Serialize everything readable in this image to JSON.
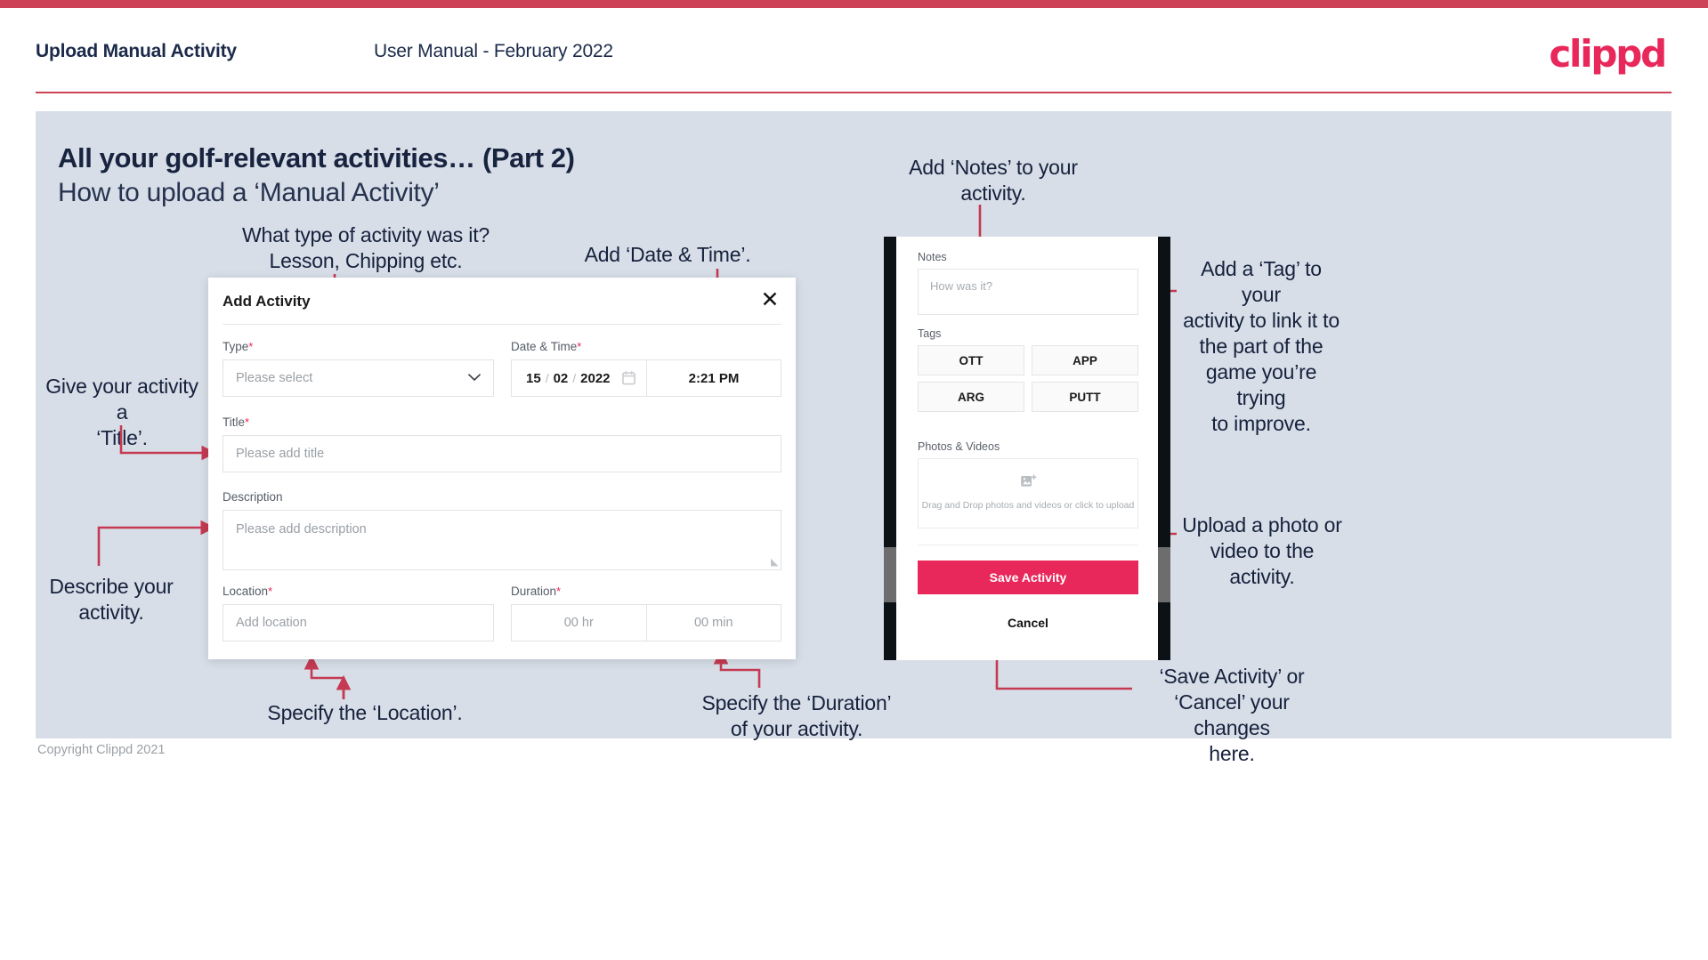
{
  "brand": {
    "logo_text": "clippd",
    "accent": "#e8275a",
    "bar": "#ce4257"
  },
  "header": {
    "left_title": "Upload Manual Activity",
    "center_title": "User Manual - February 2022"
  },
  "slide": {
    "title": "All your golf-relevant activities… (Part 2)",
    "subtitle": "How to upload a ‘Manual Activity’",
    "background": "#d7dee8"
  },
  "annotations": [
    {
      "id": "type-note",
      "text": "What type of activity was it?\nLesson, Chipping etc."
    },
    {
      "id": "datetime-note",
      "text": "Add ‘Date & Time’."
    },
    {
      "id": "title-note",
      "text": "Give your activity a\n‘Title’."
    },
    {
      "id": "describe-note",
      "text": "Describe your\nactivity."
    },
    {
      "id": "location-note",
      "text": "Specify the ‘Location’."
    },
    {
      "id": "duration-note",
      "text": "Specify the ‘Duration’\nof your activity."
    },
    {
      "id": "notes-note",
      "text": "Add ‘Notes’ to your\nactivity."
    },
    {
      "id": "tag-note",
      "text": "Add a ‘Tag’ to your\nactivity to link it to\nthe part of the\ngame you’re trying\nto improve."
    },
    {
      "id": "upload-note",
      "text": "Upload a photo or\nvideo to the activity."
    },
    {
      "id": "save-note",
      "text": "‘Save Activity’ or\n‘Cancel’ your changes\nhere."
    }
  ],
  "dialog": {
    "title": "Add Activity",
    "close_icon": "close-icon",
    "fields": {
      "type": {
        "label": "Type",
        "required": "*",
        "placeholder": "Please select",
        "icon": "chevron-down-icon"
      },
      "datetime": {
        "label": "Date & Time",
        "required": "*",
        "day": "15",
        "month": "02",
        "year": "2022",
        "sep": "/",
        "time": "2:21 PM",
        "icon": "calendar-icon"
      },
      "title": {
        "label": "Title",
        "required": "*",
        "placeholder": "Please add title"
      },
      "description": {
        "label": "Description",
        "required": "",
        "placeholder": "Please add description"
      },
      "location": {
        "label": "Location",
        "required": "*",
        "placeholder": "Add location"
      },
      "duration": {
        "label": "Duration",
        "required": "*",
        "hours": "00 hr",
        "minutes": "00 min"
      }
    }
  },
  "phone": {
    "notes": {
      "label": "Notes",
      "placeholder": "How was it?"
    },
    "tags": {
      "label": "Tags",
      "items": [
        "OTT",
        "APP",
        "ARG",
        "PUTT"
      ]
    },
    "media": {
      "label": "Photos & Videos",
      "icon": "add-image-icon",
      "drop_text": "Drag and Drop photos and videos or click to upload"
    },
    "save_label": "Save Activity",
    "cancel_label": "Cancel"
  },
  "footer": {
    "copyright": "Copyright Clippd 2021"
  }
}
